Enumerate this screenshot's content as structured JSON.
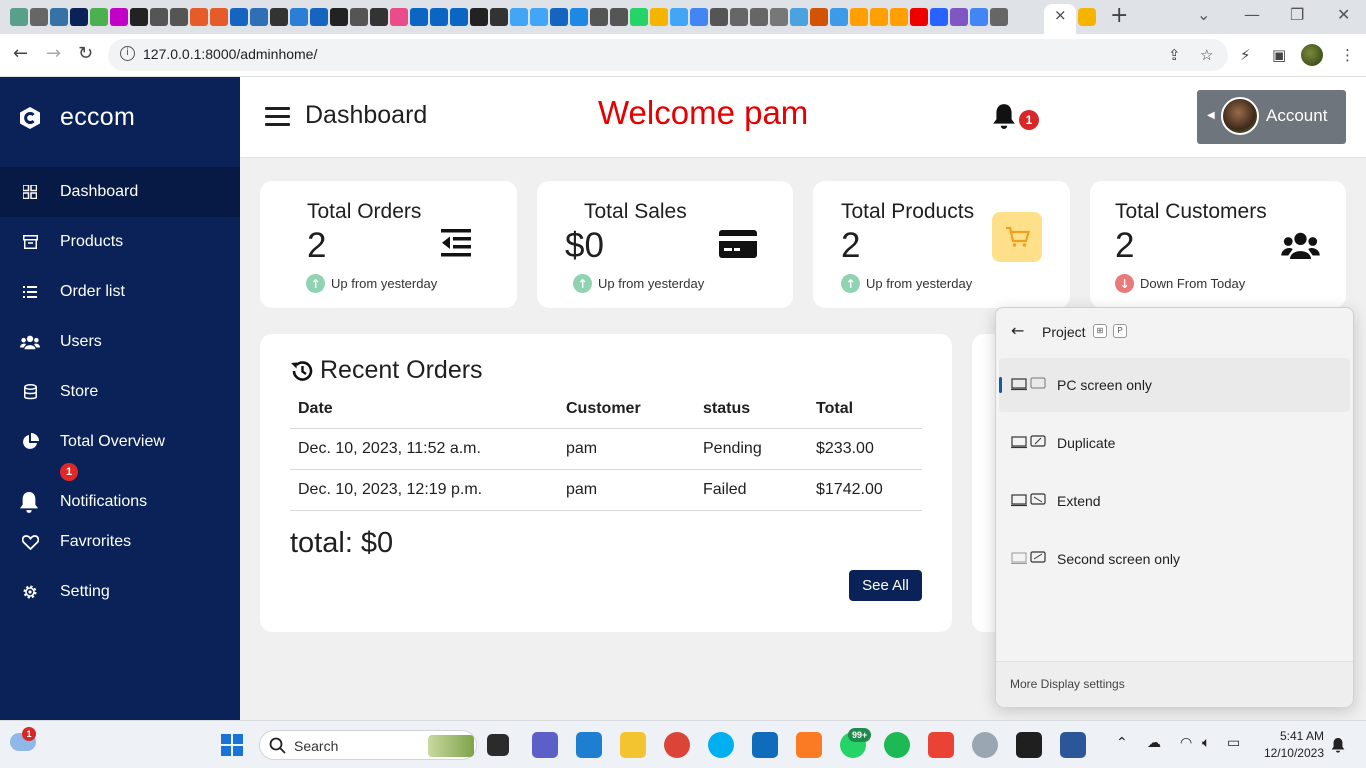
{
  "browser": {
    "url": "127.0.0.1:8000/adminhome/",
    "active_tab_close": "×",
    "new_tab": "+"
  },
  "sidebar": {
    "brand": "eccom",
    "items": [
      {
        "label": "Dashboard"
      },
      {
        "label": "Products"
      },
      {
        "label": "Order list"
      },
      {
        "label": "Users"
      },
      {
        "label": "Store"
      },
      {
        "label": "Total Overview"
      },
      {
        "label": "Notifications",
        "badge": "1"
      },
      {
        "label": "Favrorites"
      },
      {
        "label": "Setting"
      }
    ]
  },
  "header": {
    "title": "Dashboard",
    "welcome": "Welcome pam",
    "notification_count": "1",
    "account_label": "Account"
  },
  "stats": [
    {
      "title": "Total Orders",
      "value": "2",
      "trend": "Up from yesterday",
      "direction": "up",
      "icon": "indent-icon"
    },
    {
      "title": "Total Sales",
      "value": "$0",
      "trend": "Up from yesterday",
      "direction": "up",
      "icon": "credit-card-icon"
    },
    {
      "title": "Total Products",
      "value": "2",
      "trend": "Up from yesterday",
      "direction": "up",
      "icon": "cart-icon"
    },
    {
      "title": "Total Customers",
      "value": "2",
      "trend": "Down From Today",
      "direction": "down",
      "icon": "users-icon"
    }
  ],
  "recent_orders": {
    "title": "Recent Orders",
    "columns": [
      "Date",
      "Customer",
      "status",
      "Total"
    ],
    "rows": [
      [
        "Dec. 10, 2023, 11:52 a.m.",
        "pam",
        "Pending",
        "$233.00"
      ],
      [
        "Dec. 10, 2023, 12:19 p.m.",
        "pam",
        "Failed",
        "$1742.00"
      ]
    ],
    "total": "total: $0",
    "see_all": "See All"
  },
  "project_flyout": {
    "title": "Project",
    "shortcut_keys": [
      "⊞",
      "P"
    ],
    "options": [
      {
        "label": "PC screen only",
        "selected": true
      },
      {
        "label": "Duplicate",
        "selected": false
      },
      {
        "label": "Extend",
        "selected": false
      },
      {
        "label": "Second screen only",
        "selected": false
      }
    ],
    "footer": "More Display settings"
  },
  "taskbar": {
    "search_placeholder": "Search",
    "weather_badge": "1",
    "whatsapp_badge": "99+",
    "time": "5:41 AM",
    "date": "12/10/2023"
  },
  "colors": {
    "sidebar_bg": "#0a2257",
    "welcome_text": "#e60000",
    "badge_red": "#d62828",
    "trend_up": "#8fd3b2",
    "trend_down": "#e87a7a",
    "cart_icon_bg": "#ffe08a"
  }
}
